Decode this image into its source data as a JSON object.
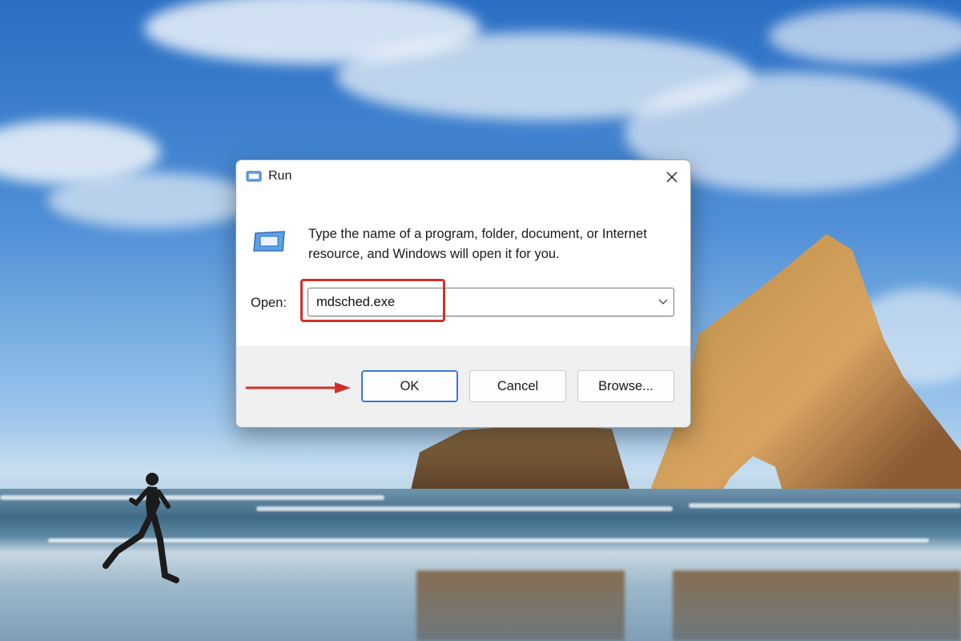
{
  "dialog": {
    "title": "Run",
    "description": "Type the name of a program, folder, document, or Internet resource, and Windows will open it for you.",
    "open_label": "Open:",
    "open_value": "mdsched.exe",
    "buttons": {
      "ok": "OK",
      "cancel": "Cancel",
      "browse": "Browse..."
    },
    "icons": {
      "title": "run-icon",
      "big": "run-icon",
      "close": "close-icon",
      "dropdown": "chevron-down-icon"
    }
  },
  "annotations": {
    "color": "#d0302c",
    "arrow": "arrow-right",
    "highlight": "open-field-highlight"
  },
  "colors": {
    "ok_border": "#3a78d4",
    "footer": "#f0f0f0"
  }
}
